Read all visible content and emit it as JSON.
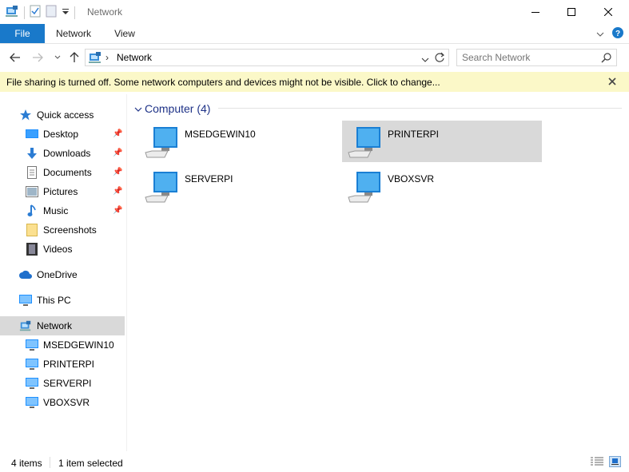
{
  "window": {
    "title": "Network"
  },
  "ribbon": {
    "tabs": [
      {
        "label": "File"
      },
      {
        "label": "Network"
      },
      {
        "label": "View"
      }
    ]
  },
  "address": {
    "path": "Network"
  },
  "search": {
    "placeholder": "Search Network"
  },
  "infobar": {
    "message": "File sharing is turned off. Some network computers and devices might not be visible. Click to change..."
  },
  "nav": {
    "quick_access": "Quick access",
    "quick_items": [
      "Desktop",
      "Downloads",
      "Documents",
      "Pictures",
      "Music",
      "Screenshots",
      "Videos"
    ],
    "onedrive": "OneDrive",
    "this_pc": "This PC",
    "network": "Network",
    "network_children": [
      "MSEDGEWIN10",
      "PRINTERPI",
      "SERVERPI",
      "VBOXSVR"
    ]
  },
  "content": {
    "group_label": "Computer (4)",
    "computers": [
      "MSEDGEWIN10",
      "PRINTERPI",
      "SERVERPI",
      "VBOXSVR"
    ],
    "selected": "PRINTERPI"
  },
  "status": {
    "item_count": "4 items",
    "selection": "1 item selected"
  },
  "colors": {
    "accent": "#1979ca",
    "infobar": "#fbf8c8",
    "selection": "#d9d9d9",
    "nav_selected": "#d9d9d9"
  }
}
